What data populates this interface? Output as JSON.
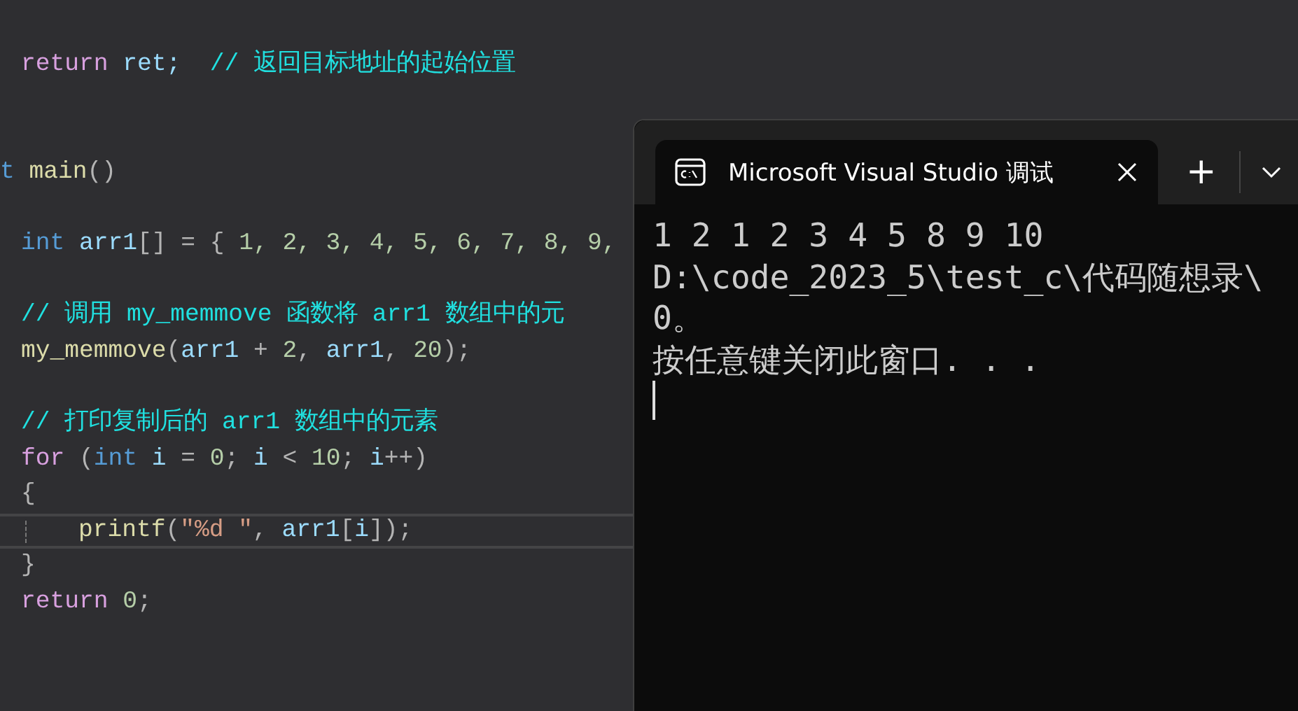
{
  "editor": {
    "lines": [
      {
        "kind": "line",
        "current": false,
        "tokens": [
          {
            "text": "return",
            "color": "#d8a0df"
          },
          {
            "text": " ret; ",
            "color": "#9cdcfe"
          },
          {
            "text": " // 返回目标地址的起始位置",
            "color": "#20e0e0"
          }
        ]
      },
      {
        "kind": "blank"
      },
      {
        "kind": "blank"
      },
      {
        "kind": "outer",
        "current": false,
        "tokens": [
          {
            "text": "t ",
            "color": "#569cd6"
          },
          {
            "text": "main",
            "color": "#dcdcaa"
          },
          {
            "text": "()",
            "color": "#b4b4b4"
          }
        ]
      },
      {
        "kind": "blank"
      },
      {
        "kind": "line",
        "current": false,
        "tokens": [
          {
            "text": "int",
            "color": "#569cd6"
          },
          {
            "text": " arr1",
            "color": "#9cdcfe"
          },
          {
            "text": "[] = { ",
            "color": "#b4b4b4"
          },
          {
            "text": "1, 2, 3, 4, 5, 6, 7, 8, 9,",
            "color": "#b5cea8"
          }
        ]
      },
      {
        "kind": "blank"
      },
      {
        "kind": "line",
        "current": false,
        "tokens": [
          {
            "text": "// 调用 my_memmove 函数将 arr1 数组中的元",
            "color": "#20e0e0"
          }
        ]
      },
      {
        "kind": "line",
        "current": false,
        "tokens": [
          {
            "text": "my_memmove",
            "color": "#dcdcaa"
          },
          {
            "text": "(",
            "color": "#b4b4b4"
          },
          {
            "text": "arr1",
            "color": "#9cdcfe"
          },
          {
            "text": " + ",
            "color": "#b4b4b4"
          },
          {
            "text": "2",
            "color": "#b5cea8"
          },
          {
            "text": ", ",
            "color": "#b4b4b4"
          },
          {
            "text": "arr1",
            "color": "#9cdcfe"
          },
          {
            "text": ", ",
            "color": "#b4b4b4"
          },
          {
            "text": "20",
            "color": "#b5cea8"
          },
          {
            "text": ");",
            "color": "#b4b4b4"
          }
        ]
      },
      {
        "kind": "blank"
      },
      {
        "kind": "line",
        "current": false,
        "tokens": [
          {
            "text": "// 打印复制后的 arr1 数组中的元素",
            "color": "#20e0e0"
          }
        ]
      },
      {
        "kind": "line",
        "current": false,
        "tokens": [
          {
            "text": "for",
            "color": "#d8a0df"
          },
          {
            "text": " (",
            "color": "#b4b4b4"
          },
          {
            "text": "int",
            "color": "#569cd6"
          },
          {
            "text": " i",
            "color": "#9cdcfe"
          },
          {
            "text": " = ",
            "color": "#b4b4b4"
          },
          {
            "text": "0",
            "color": "#b5cea8"
          },
          {
            "text": "; ",
            "color": "#b4b4b4"
          },
          {
            "text": "i",
            "color": "#9cdcfe"
          },
          {
            "text": " < ",
            "color": "#b4b4b4"
          },
          {
            "text": "10",
            "color": "#b5cea8"
          },
          {
            "text": "; ",
            "color": "#b4b4b4"
          },
          {
            "text": "i",
            "color": "#9cdcfe"
          },
          {
            "text": "++)",
            "color": "#b4b4b4"
          }
        ]
      },
      {
        "kind": "line",
        "current": false,
        "tokens": [
          {
            "text": "{",
            "color": "#b4b4b4"
          }
        ]
      },
      {
        "kind": "inner",
        "current": true,
        "tokens": [
          {
            "text": "printf",
            "color": "#dcdcaa"
          },
          {
            "text": "(",
            "color": "#b4b4b4"
          },
          {
            "text": "\"%d \"",
            "color": "#d69d85"
          },
          {
            "text": ", ",
            "color": "#b4b4b4"
          },
          {
            "text": "arr1",
            "color": "#9cdcfe"
          },
          {
            "text": "[",
            "color": "#b4b4b4"
          },
          {
            "text": "i",
            "color": "#9cdcfe"
          },
          {
            "text": "]);",
            "color": "#b4b4b4"
          }
        ]
      },
      {
        "kind": "line",
        "current": false,
        "tokens": [
          {
            "text": "}",
            "color": "#b4b4b4"
          }
        ]
      },
      {
        "kind": "line",
        "current": false,
        "tokens": [
          {
            "text": "return",
            "color": "#d8a0df"
          },
          {
            "text": " 0",
            "color": "#b5cea8"
          },
          {
            "text": ";",
            "color": "#b4b4b4"
          }
        ]
      }
    ]
  },
  "terminal": {
    "tab": {
      "title": "Microsoft Visual Studio 调试",
      "selected": true
    },
    "new_tab": "+",
    "output": [
      "1 2 1 2 3 4 5 8 9 10",
      "D:\\code_2023_5\\test_c\\代码随想录\\",
      "0。",
      "按任意键关闭此窗口. . ."
    ],
    "cursor": true
  }
}
